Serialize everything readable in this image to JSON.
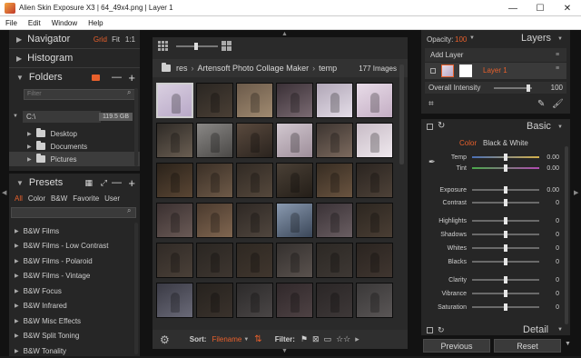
{
  "window": {
    "title": "Alien Skin Exposure X3 | 64_49x4.png | Layer 1",
    "minimize": "—",
    "maximize": "☐",
    "close": "✕"
  },
  "menu": [
    "File",
    "Edit",
    "Window",
    "Help"
  ],
  "navigator": {
    "title": "Navigator",
    "opts": [
      "Grid",
      "Fit",
      "1:1"
    ]
  },
  "histogram": {
    "title": "Histogram"
  },
  "folders": {
    "title": "Folders",
    "minus": "—",
    "plus": "+",
    "search_placeholder": "Filter",
    "drive": {
      "label": "C:\\",
      "size": "119.5 GB"
    },
    "items": [
      "Desktop",
      "Documents",
      "Pictures"
    ]
  },
  "presets": {
    "title": "Presets",
    "tabs": [
      "All",
      "Color",
      "B&W",
      "Favorite",
      "User"
    ],
    "items": [
      "B&W Films",
      "B&W Films - Low Contrast",
      "B&W Films - Polaroid",
      "B&W Films - Vintage",
      "B&W Focus",
      "B&W Infrared",
      "B&W Misc Effects",
      "B&W Split Toning",
      "B&W Tonality"
    ]
  },
  "browser": {
    "breadcrumb": [
      "res",
      "Artensoft Photo Collage Maker",
      "temp"
    ],
    "count": "177 Images",
    "sort_label": "Sort:",
    "sort_value": "Filename",
    "filter_label": "Filter:"
  },
  "layers": {
    "opacity_label": "Opacity:",
    "opacity_value": "100",
    "title": "Layers",
    "add_layer": "Add Layer",
    "layer_name": "Layer 1",
    "intensity_label": "Overall Intensity",
    "intensity_value": "100",
    "intensity_level": 0.95
  },
  "basic": {
    "title": "Basic",
    "tabs": [
      "Color",
      "Black & White"
    ],
    "sliders": [
      {
        "label": "Temp",
        "value": "0.00"
      },
      {
        "label": "Tint",
        "value": "0.00"
      },
      {
        "label": "Exposure",
        "value": "0.00"
      },
      {
        "label": "Contrast",
        "value": "0"
      },
      {
        "label": "Highlights",
        "value": "0"
      },
      {
        "label": "Shadows",
        "value": "0"
      },
      {
        "label": "Whites",
        "value": "0"
      },
      {
        "label": "Blacks",
        "value": "0"
      },
      {
        "label": "Clarity",
        "value": "0"
      },
      {
        "label": "Vibrance",
        "value": "0"
      },
      {
        "label": "Saturation",
        "value": "0"
      }
    ]
  },
  "detail": {
    "title": "Detail"
  },
  "buttons": {
    "previous": "Previous",
    "reset": "Reset"
  },
  "colors": {
    "accent": "#e8602c",
    "panel": "#262626",
    "background": "#121212"
  }
}
